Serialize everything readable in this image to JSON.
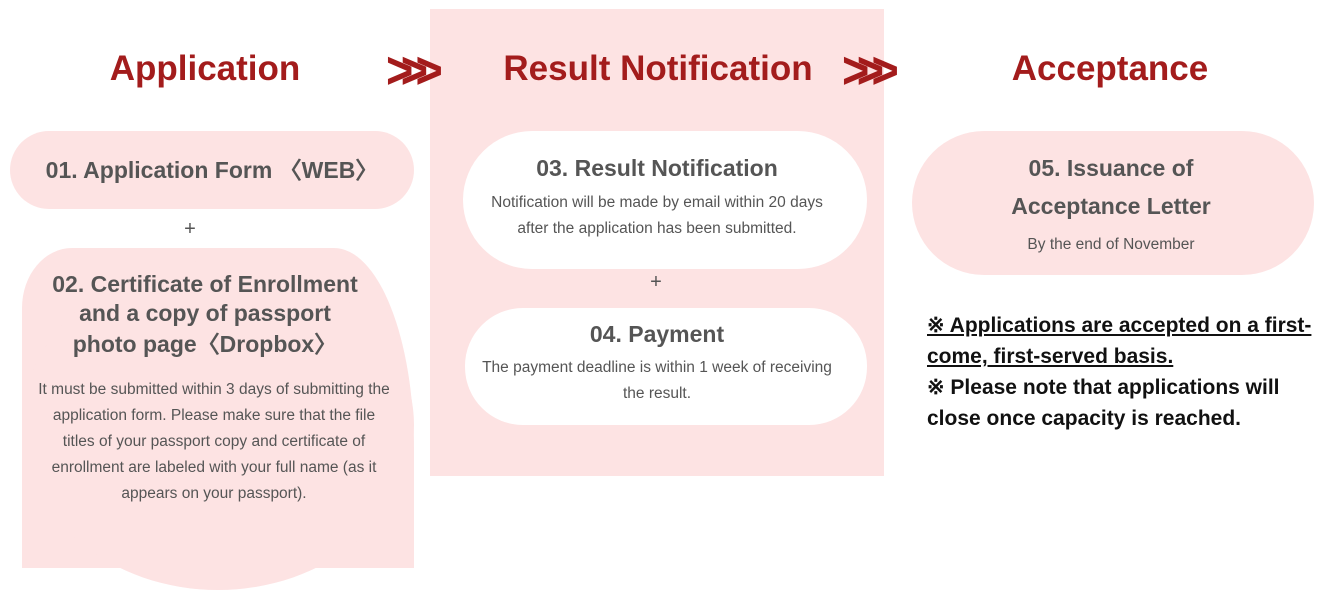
{
  "headers": {
    "application": "Application",
    "result": "Result Notification",
    "acceptance": "Acceptance"
  },
  "arrows": ">>>",
  "steps": {
    "s01": {
      "title": "01. Application Form 〈WEB〉"
    },
    "s02": {
      "title_line1": "02. Certificate of Enrollment",
      "title_line2": "and a copy of passport",
      "title_line3": "photo page〈Dropbox〉",
      "desc": "It must be submitted within 3 days of submitting the application form. Please make sure that the file titles of your passport copy and certificate of enrollment are labeled with your full name (as it appears on your passport)."
    },
    "s03": {
      "title": "03. Result Notification",
      "desc": "Notification will be made by email within 20 days after the application has been submitted."
    },
    "s04": {
      "title": "04. Payment",
      "desc": "The payment deadline is within 1 week of receiving the result."
    },
    "s05": {
      "title_line1": "05. Issuance of",
      "title_line2": "Acceptance Letter",
      "desc": "By the end of November"
    }
  },
  "plus": "+",
  "notes": {
    "note1": "※ Applications are accepted on a first-come, first-served basis.",
    "note2": "※ Please note that applications will close once capacity is reached."
  },
  "colors": {
    "accent": "#a31c1c",
    "pill_pink": "#fde3e3",
    "panel_pink": "#fde3e3",
    "text_gray": "#555555"
  }
}
